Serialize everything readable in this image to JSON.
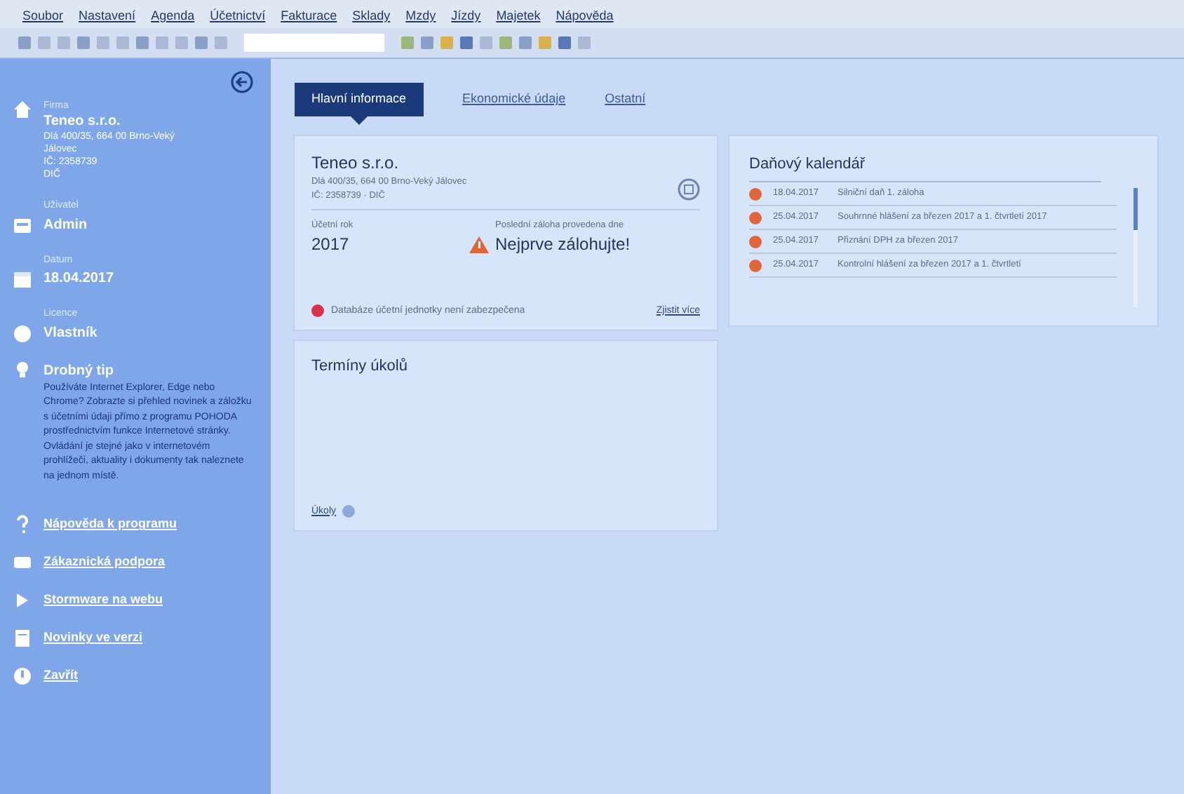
{
  "menu": [
    "Soubor",
    "Nastavení",
    "Agenda",
    "Účetnictví",
    "Fakturace",
    "Sklady",
    "Mzdy",
    "Jízdy",
    "Majetek",
    "Nápověda"
  ],
  "sidebar": {
    "company": {
      "label": "Firma",
      "name": "Teneo s.r.o.",
      "lines": [
        "Dlá 400/35, 664 00 Brno-Veký",
        "Jálovec",
        "IČ: 2358739",
        "DIČ"
      ]
    },
    "fields": [
      {
        "kind": "user",
        "label": "Uživatel",
        "value": "Admin"
      },
      {
        "kind": "date",
        "label": "Datum",
        "value": "18.04.2017"
      },
      {
        "kind": "licence",
        "label": "Licence",
        "value": "Vlastník"
      }
    ],
    "tip": {
      "title": "Drobný tip",
      "text": "Používáte Internet Explorer, Edge nebo Chrome? Zobrazte si přehled novinek a záložku s účetními údaji přímo z programu POHODA prostřednictvím funkce Internetové stránky. Ovládání je stejné jako v internetovém prohlížeči, aktuality i dokumenty tak naleznete na jednom místě."
    },
    "links": [
      {
        "kind": "help",
        "label": "Nápověda k programu"
      },
      {
        "kind": "support",
        "label": "Zákaznická podpora"
      },
      {
        "kind": "web",
        "label": "Stormware na webu"
      },
      {
        "kind": "news",
        "label": "Novinky ve verzi"
      },
      {
        "kind": "close",
        "label": "Zavřít"
      }
    ]
  },
  "tabs": [
    {
      "label": "Hlavní informace",
      "selected": true
    },
    {
      "label": "Ekonomické údaje",
      "selected": false
    },
    {
      "label": "Ostatní",
      "selected": false
    }
  ],
  "company_card": {
    "name": "Teneo s.r.o.",
    "address": "Dlá 400/35, 664 00 Brno-Veký Jálovec",
    "ids": "IČ: 2358739 · DIČ",
    "year_label": "Účetní rok",
    "year": "2017",
    "backup_label": "Poslední záloha provedena dne",
    "backup_value": "Nejprve zálohujte!",
    "warning": "Databáze účetní jednotky není zabezpečena",
    "more_link": "Zjistit více"
  },
  "tasks_card": {
    "title": "Termíny úkolů",
    "link": "Úkoly"
  },
  "tax_calendar": {
    "title": "Daňový kalendář",
    "rows": [
      {
        "date": "18.04.2017",
        "text": "Silniční daň 1. záloha"
      },
      {
        "date": "25.04.2017",
        "text": "Souhrnné hlášení za březen 2017 a 1. čtvrtletí 2017"
      },
      {
        "date": "25.04.2017",
        "text": "Přiznání DPH za březen 2017"
      },
      {
        "date": "25.04.2017",
        "text": "Kontrolní hlášení za březen 2017 a 1. čtvrtletí"
      }
    ]
  }
}
